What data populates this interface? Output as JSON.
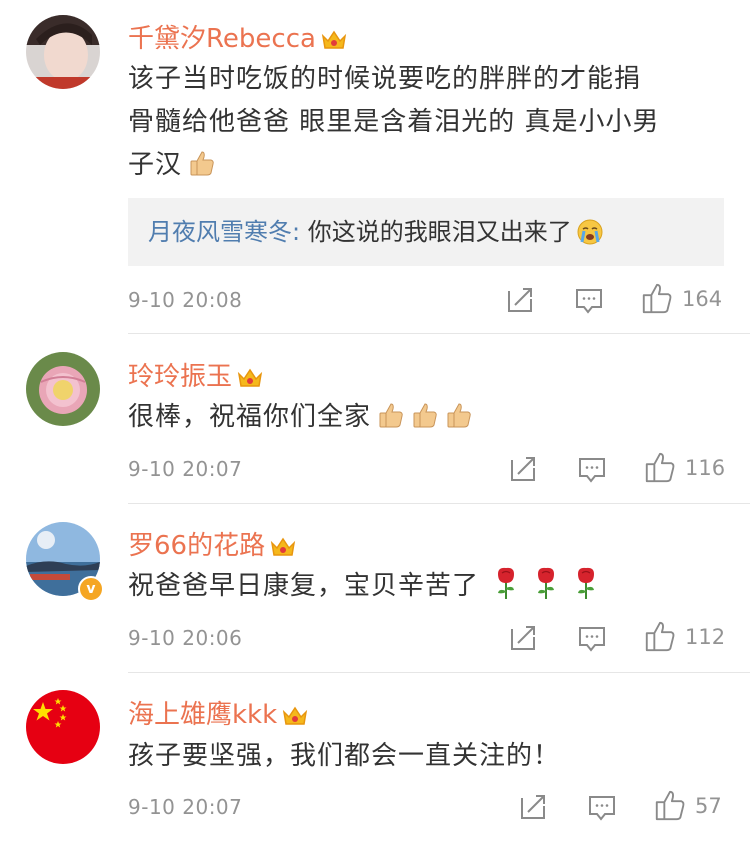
{
  "comments": [
    {
      "username": "千黛汐Rebecca",
      "text_lines": [
        "该子当时吃饭的时候说要吃的胖胖的才能捐",
        "骨髓给他爸爸 眼里是含着泪光的 真是小小男",
        "子汉"
      ],
      "emoji": "thumbs-up",
      "reply": {
        "name": "月夜风雪寒冬:",
        "text": " 你这说的我眼泪又出来了"
      },
      "time": "9-10 20:08",
      "likes": "164"
    },
    {
      "username": "玲玲振玉",
      "text": "很棒，祝福你们全家",
      "emoji": "thumbs-up x3",
      "time": "9-10 20:07",
      "likes": "116"
    },
    {
      "username": "罗66的花路",
      "text": "祝爸爸早日康复，宝贝辛苦了",
      "emoji": "rose x3",
      "time": "9-10 20:06",
      "likes": "112"
    },
    {
      "username": "海上雄鹰kkk",
      "text": "孩子要坚强，我们都会一直关注的！",
      "time": "9-10 20:07",
      "likes": "57"
    }
  ],
  "colors": {
    "username": "#eb7350",
    "reply_name": "#507daf",
    "meta": "#939393",
    "reply_bg": "#f2f2f2"
  },
  "icons": [
    "crown-badge-icon",
    "share-icon",
    "comment-icon",
    "like-icon",
    "verified-icon"
  ]
}
